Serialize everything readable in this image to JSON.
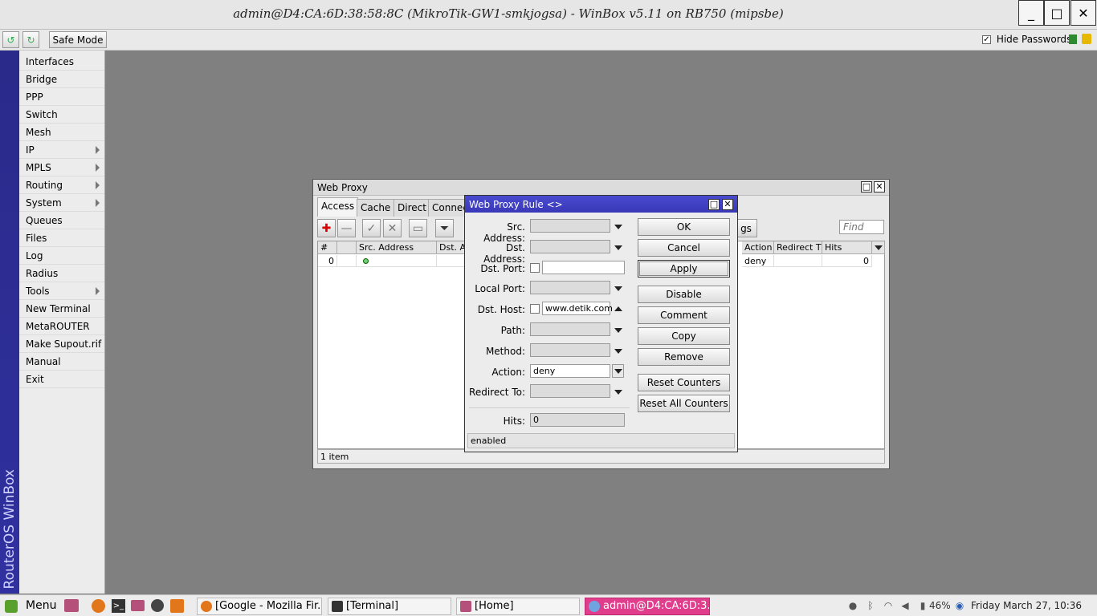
{
  "window": {
    "title": "admin@D4:CA:6D:38:58:8C (MikroTik-GW1-smkjogsa) - WinBox v5.11 on RB750 (mipsbe)",
    "minimize": "_",
    "maximize": "□",
    "close": "✕"
  },
  "toolbar": {
    "undo": "↺",
    "redo": "↻",
    "safe_mode": "Safe Mode",
    "hide_passwords": "Hide Passwords",
    "hide_passwords_checked": true
  },
  "side_label": "RouterOS WinBox",
  "menu": [
    {
      "label": "Interfaces",
      "submenu": false
    },
    {
      "label": "Bridge",
      "submenu": false
    },
    {
      "label": "PPP",
      "submenu": false
    },
    {
      "label": "Switch",
      "submenu": false
    },
    {
      "label": "Mesh",
      "submenu": false
    },
    {
      "label": "IP",
      "submenu": true
    },
    {
      "label": "MPLS",
      "submenu": true
    },
    {
      "label": "Routing",
      "submenu": true
    },
    {
      "label": "System",
      "submenu": true
    },
    {
      "label": "Queues",
      "submenu": false
    },
    {
      "label": "Files",
      "submenu": false
    },
    {
      "label": "Log",
      "submenu": false
    },
    {
      "label": "Radius",
      "submenu": false
    },
    {
      "label": "Tools",
      "submenu": true
    },
    {
      "label": "New Terminal",
      "submenu": false
    },
    {
      "label": "MetaROUTER",
      "submenu": false
    },
    {
      "label": "Make Supout.rif",
      "submenu": false
    },
    {
      "label": "Manual",
      "submenu": false
    },
    {
      "label": "Exit",
      "submenu": false
    }
  ],
  "web_proxy": {
    "title": "Web Proxy",
    "tabs": [
      "Access",
      "Cache",
      "Direct",
      "Connec"
    ],
    "find_placeholder": "Find",
    "settings_partial": "gs",
    "columns": [
      "#",
      "",
      "Src. Address",
      "Dst. Ac",
      "Action",
      "Redirect T",
      "Hits"
    ],
    "rows": [
      {
        "num": "0",
        "action": "deny",
        "hits": "0"
      }
    ],
    "status": "1 item"
  },
  "rule": {
    "title": "Web Proxy Rule <>",
    "fields": {
      "src_address": {
        "label": "Src. Address:",
        "value": ""
      },
      "dst_address": {
        "label": "Dst. Address:",
        "value": ""
      },
      "dst_port": {
        "label": "Dst. Port:",
        "value": ""
      },
      "local_port": {
        "label": "Local Port:",
        "value": ""
      },
      "dst_host": {
        "label": "Dst. Host:",
        "value": "www.detik.com"
      },
      "path": {
        "label": "Path:",
        "value": ""
      },
      "method": {
        "label": "Method:",
        "value": ""
      },
      "action": {
        "label": "Action:",
        "value": "deny"
      },
      "redirect_to": {
        "label": "Redirect To:",
        "value": ""
      },
      "hits": {
        "label": "Hits:",
        "value": "0"
      }
    },
    "buttons": {
      "ok": "OK",
      "cancel": "Cancel",
      "apply": "Apply",
      "disable": "Disable",
      "comment": "Comment",
      "copy": "Copy",
      "remove": "Remove",
      "reset_counters": "Reset Counters",
      "reset_all_counters": "Reset All Counters"
    },
    "status": "enabled"
  },
  "taskbar": {
    "menu": "Menu",
    "tasks": [
      "[Google - Mozilla Fir...",
      "[Terminal]",
      "[Home]",
      "admin@D4:CA:6D:3..."
    ],
    "battery": "46%",
    "clock": "Friday March 27, 10:36"
  },
  "colors": {
    "accent": "#3838b8",
    "active_task": "#e03e8c",
    "desktop": "#808080"
  }
}
